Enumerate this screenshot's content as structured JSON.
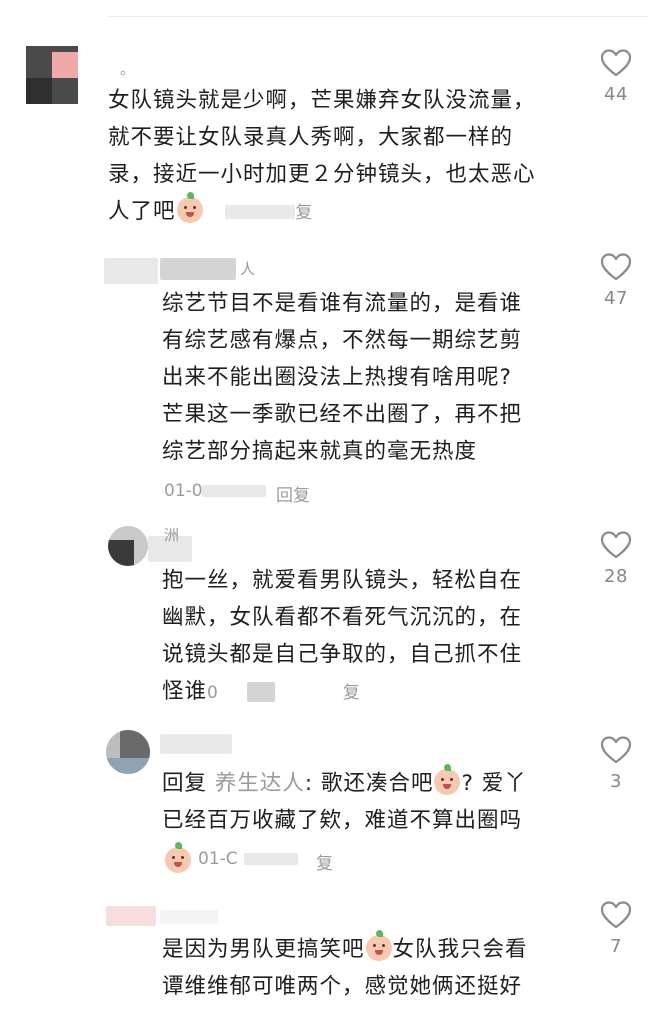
{
  "comments": [
    {
      "name": "。",
      "lines": [
        "女队镜头就是少啊，芒果嫌弃女队没流量，",
        "就不要让女队录真人秀啊，大家都一样的",
        "录，接近一小时加更２分钟镜头，也太恶心",
        "人了吧"
      ],
      "meta_tail": "复",
      "likes": "44"
    },
    {
      "name": "人",
      "lines": [
        "综艺节目不是看谁有流量的，是看谁",
        "有综艺感有爆点，不然每一期综艺剪",
        "出来不能出圈没法上热搜有啥用呢?",
        "芒果这一季歌已经不出圈了，再不把",
        "综艺部分搞起来就真的毫无热度"
      ],
      "meta_date": "01-0",
      "meta_reply": "回复",
      "likes": "47"
    },
    {
      "name": "洲",
      "lines": [
        "抱一丝，就爱看男队镜头，轻松自在",
        "幽默，女队看都不看死气沉沉的，在",
        "说镜头都是自己争取的，自己抓不住",
        "怪谁"
      ],
      "meta_inline_date": "0",
      "meta_inline_reply": "复",
      "likes": "28"
    },
    {
      "name": "",
      "reply_prefix": "回复",
      "reply_user": "养生达人",
      "lines": [
        ": 歌还凑合吧",
        "? 爱丫",
        "已经百万收藏了欸，难道不算出圈吗"
      ],
      "meta_date": "01-C",
      "meta_reply": "复",
      "likes": "3"
    },
    {
      "name": "",
      "lines": [
        "是因为男队更搞笑吧",
        "女队我只会看",
        "谭维维郁可唯两个，感觉她俩还挺好"
      ],
      "likes": "7"
    }
  ],
  "icons": {
    "like": "heart-outline-icon",
    "emoji": "laughing-face-emoji-icon"
  },
  "colors": {
    "text": "#1e1e1e",
    "muted": "#9a9a9a",
    "heart_stroke": "#8a8a8a"
  }
}
